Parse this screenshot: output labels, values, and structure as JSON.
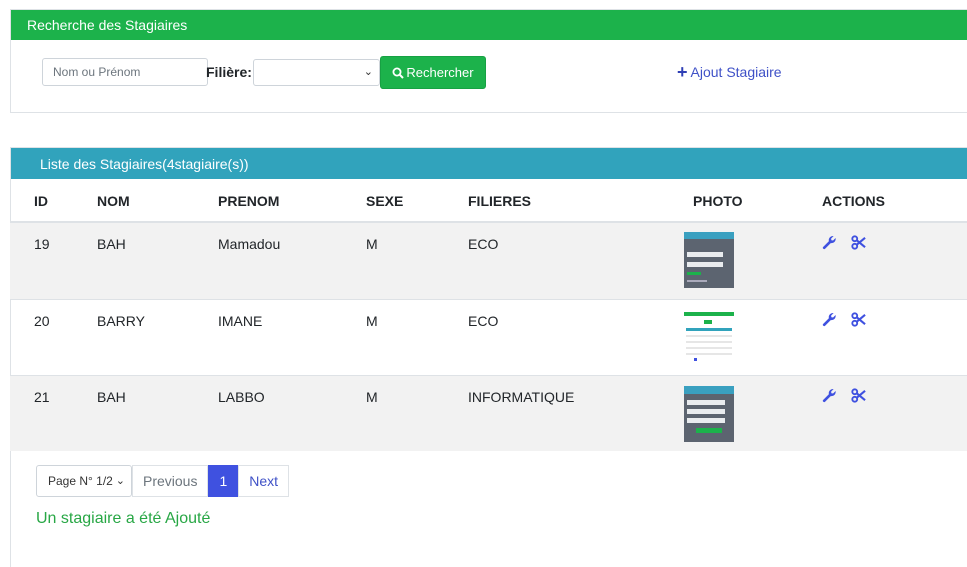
{
  "search_panel": {
    "title": "Recherche des Stagiaires",
    "search_placeholder": "Nom ou Prénom",
    "filiere_label": "Filière:",
    "filiere_selected": "",
    "search_button": "Rechercher",
    "add_link": "Ajout Stagiaire"
  },
  "list_panel": {
    "title": "Liste des Stagiaires(4stagiaire(s))",
    "columns": [
      "ID",
      "NOM",
      "PRENOM",
      "SEXE",
      "FILIERES",
      "PHOTO",
      "ACTIONS"
    ],
    "rows": [
      {
        "id": "19",
        "nom": "BAH",
        "prenom": "Mamadou",
        "sexe": "M",
        "filiere": "ECO"
      },
      {
        "id": "20",
        "nom": "BARRY",
        "prenom": "IMANE",
        "sexe": "M",
        "filiere": "ECO"
      },
      {
        "id": "21",
        "nom": "BAH",
        "prenom": "LABBO",
        "sexe": "M",
        "filiere": "INFORMATIQUE"
      }
    ]
  },
  "pagination": {
    "page_select": "Page N° 1/2",
    "previous": "Previous",
    "current": "1",
    "next": "Next"
  },
  "message": "Un stagiaire a été Ajouté",
  "colors": {
    "green": "#1cb24b",
    "teal": "#31a3bc",
    "primary": "#3f51c7"
  }
}
